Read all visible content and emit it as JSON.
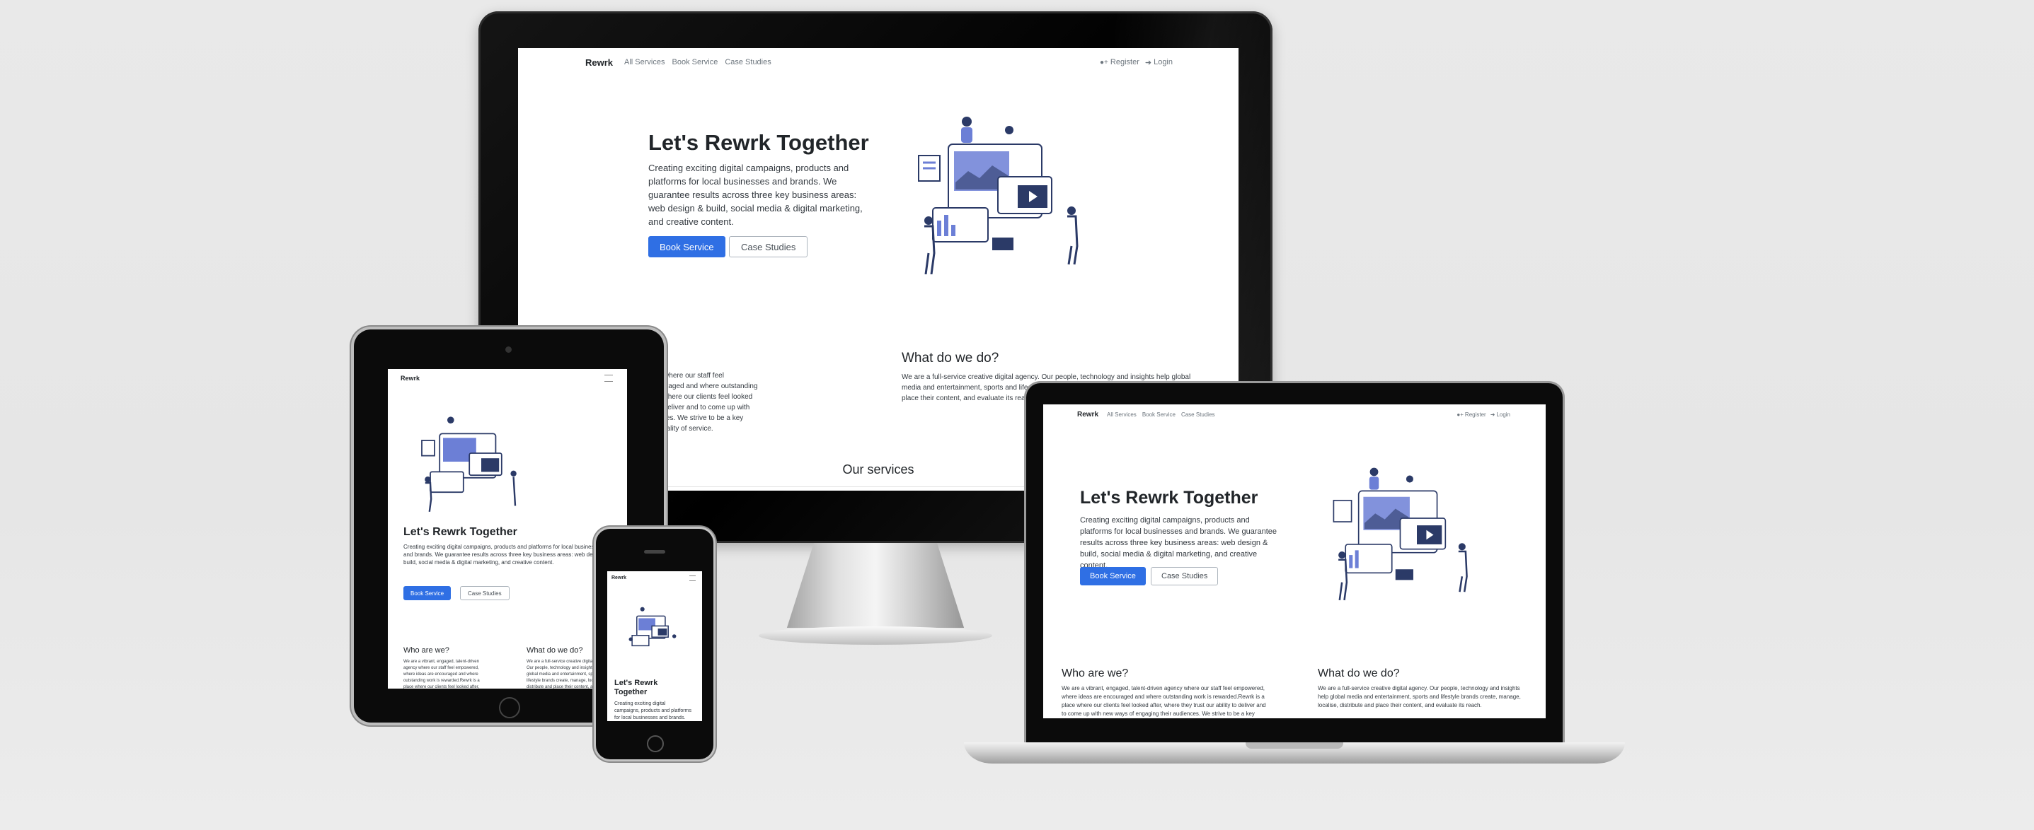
{
  "nav": {
    "brand": "Rewrk",
    "links": [
      "All Services",
      "Book Service",
      "Case Studies"
    ],
    "register": "Register",
    "login": "Login"
  },
  "hero": {
    "title": "Let's Rewrk Together",
    "title_phone": "Let's Rewrk Together",
    "text": "Creating exciting digital campaigns, products and platforms for local businesses and brands. We guarantee results across three key business areas: web design & build, social media & digital marketing, and creative content.",
    "primary_button": "Book Service",
    "secondary_button": "Case Studies"
  },
  "about": {
    "who_title": "Who are we?",
    "who_text": "We are a vibrant, engaged, talent-driven agency where our staff feel empowered, where ideas are encouraged and where outstanding work is rewarded.Rewrk is a place where our clients feel looked after, where they trust our ability to deliver and to come up with new ways of engaging their audiences. We strive to be a key agency partner to our clients and quality of service.",
    "what_title": "What do we do?",
    "what_text": "We are a full-service creative digital agency. Our people, technology and insights help global media and entertainment, sports and lifestyle brands create, manage, localise, distribute and place their content, and evaluate its reach."
  },
  "services": {
    "title": "Our services"
  },
  "colors": {
    "primary": "#2f6fe4",
    "illustration": "#6c7fd6",
    "illustration_dark": "#2b3a67",
    "background": "#e8e8e8"
  },
  "icons": [
    "register-user-icon",
    "login-icon",
    "hamburger-menu-icon"
  ]
}
